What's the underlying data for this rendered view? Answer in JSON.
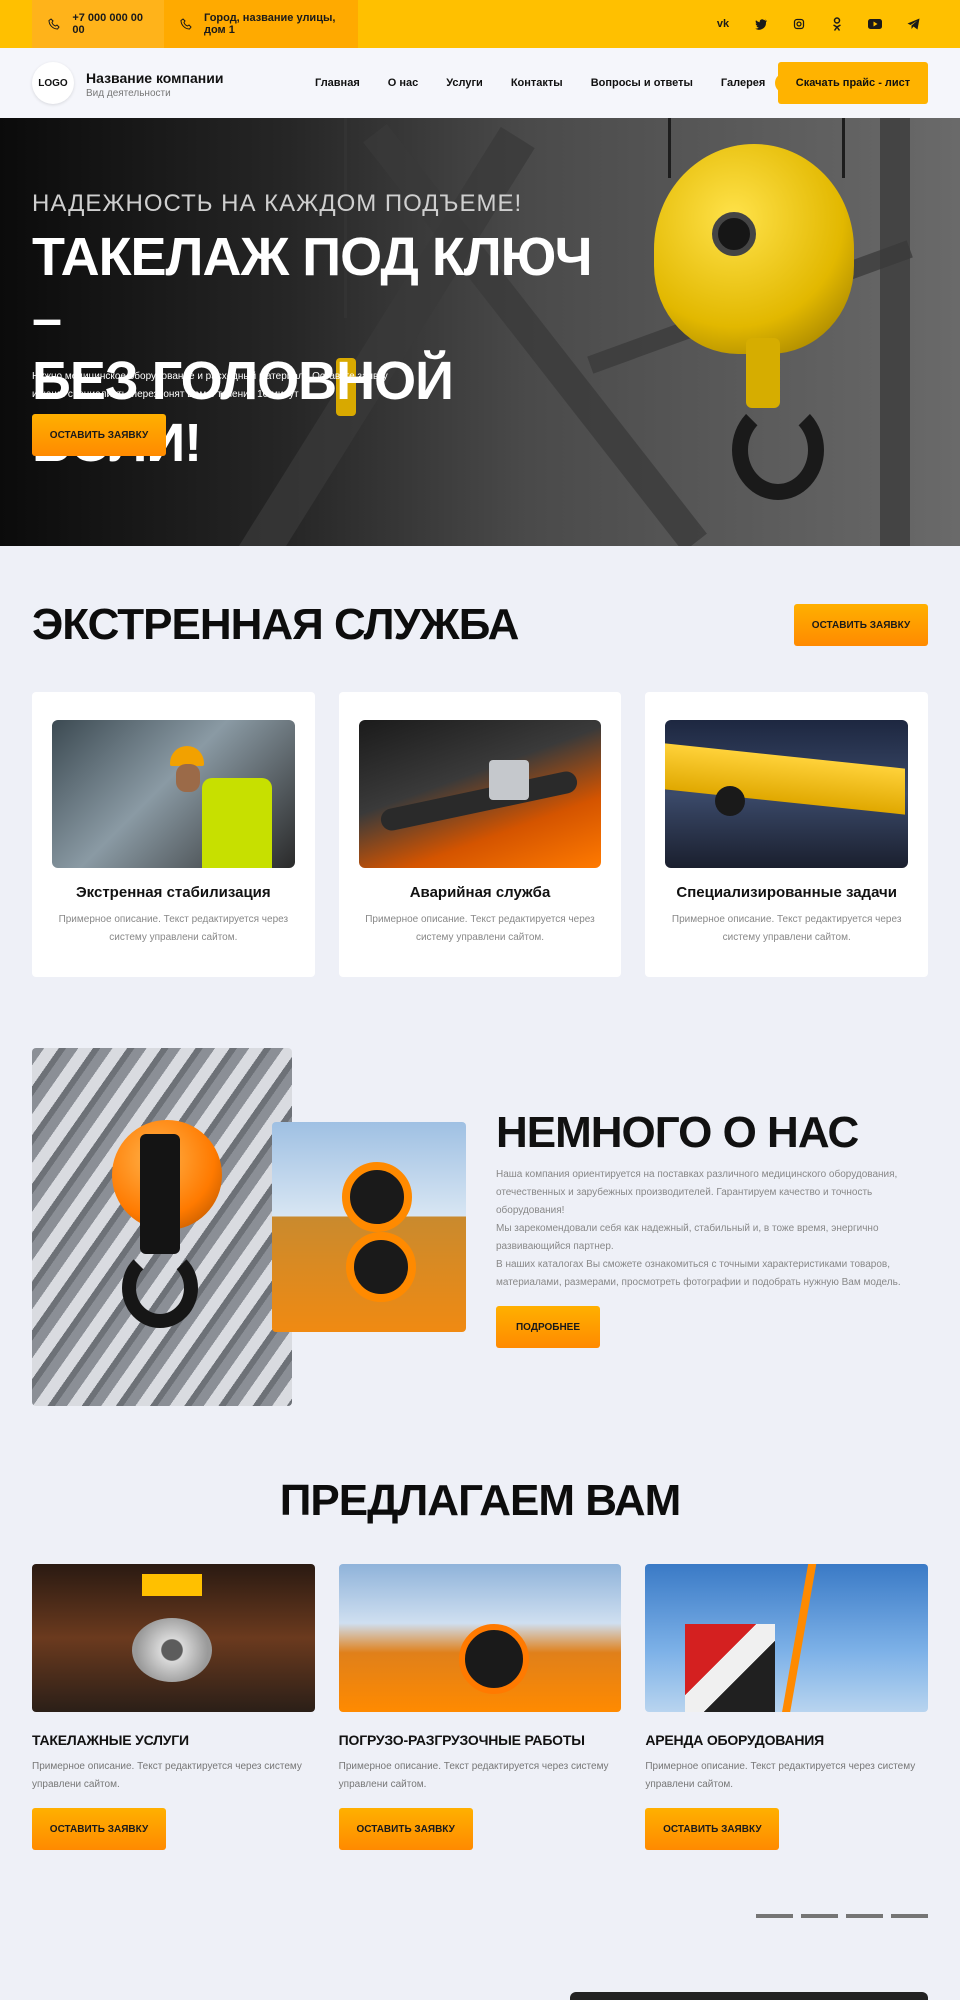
{
  "topbar": {
    "phone": "+7 000 000 00 00",
    "address": "Город, название улицы, дом 1",
    "socials": [
      "vk-icon",
      "twitter-icon",
      "instagram-icon",
      "odnoklassniki-icon",
      "youtube-icon",
      "telegram-icon"
    ]
  },
  "header": {
    "logo": "LOGO",
    "company_name": "Название компании",
    "activity": "Вид деятельности",
    "nav": [
      "Главная",
      "О нас",
      "Услуги",
      "Контакты",
      "Вопросы и ответы",
      "Галерея"
    ],
    "price_button": "Скачать прайс - лист"
  },
  "hero": {
    "subtitle": "НАДЕЖНОСТЬ НА КАЖДОМ ПОДЪЕМЕ!",
    "title_line1": "ТАКЕЛАЖ ПОД КЛЮЧ –",
    "title_line2": "БЕЗ ГОЛОВНОЙ БОЛИ!",
    "desc_line1": "Нужно медицинское оборудование и расходный материал? Оставьте заявку",
    "desc_line2": "и наши специалисты перезвонят Вам в течение 10 минут",
    "button": "ОСТАВИТЬ ЗАЯВКУ"
  },
  "emergency": {
    "title": "ЭКСТРЕННАЯ СЛУЖБА",
    "button": "ОСТАВИТЬ ЗАЯВКУ",
    "cards": [
      {
        "title": "Экстренная стабилизация",
        "desc": "Примерное описание. Текст редактируется через систему управлени сайтом."
      },
      {
        "title": "Аварийная служба",
        "desc": "Примерное описание. Текст редактируется через систему управлени сайтом."
      },
      {
        "title": "Специализированные задачи",
        "desc": "Примерное описание. Текст редактируется через систему управлени сайтом."
      }
    ]
  },
  "about": {
    "title": "НЕМНОГО О НАС",
    "p1": "Наша компания ориентируется на поставках различного медицинского оборудования, отечественных и зарубежных производителей. Гарантируем качество и точность оборудования!",
    "p2": "Мы зарекомендовали себя как надежный, стабильный и, в тоже время, энергично развивающийся партнер.",
    "p3": "В наших каталогах Вы сможете ознакомиться с точными характеристиками товаров, материалами, размерами, просмотреть фотографии и подобрать нужную Вам модель.",
    "button": "ПОДРОБНЕЕ"
  },
  "offer": {
    "title": "ПРЕДЛАГАЕМ ВАМ",
    "items": [
      {
        "title": "ТАКЕЛАЖНЫЕ УСЛУГИ",
        "desc": "Примерное описание. Текст редактируется через систему управлени сайтом.",
        "button": "ОСТАВИТЬ ЗАЯВКУ"
      },
      {
        "title": "ПОГРУЗО-РАЗГРУЗОЧНЫЕ РАБОТЫ",
        "desc": "Примерное описание. Текст редактируется через систему управлени сайтом.",
        "button": "ОСТАВИТЬ ЗАЯВКУ"
      },
      {
        "title": "АРЕНДА ОБОРУДОВАНИЯ",
        "desc": "Примерное описание. Текст редактируется через систему управлени сайтом.",
        "button": "ОСТАВИТЬ ЗАЯВКУ"
      }
    ]
  },
  "colors": {
    "accent": "#ffc000",
    "button": "#ff9a00",
    "background": "#eef0f7"
  }
}
